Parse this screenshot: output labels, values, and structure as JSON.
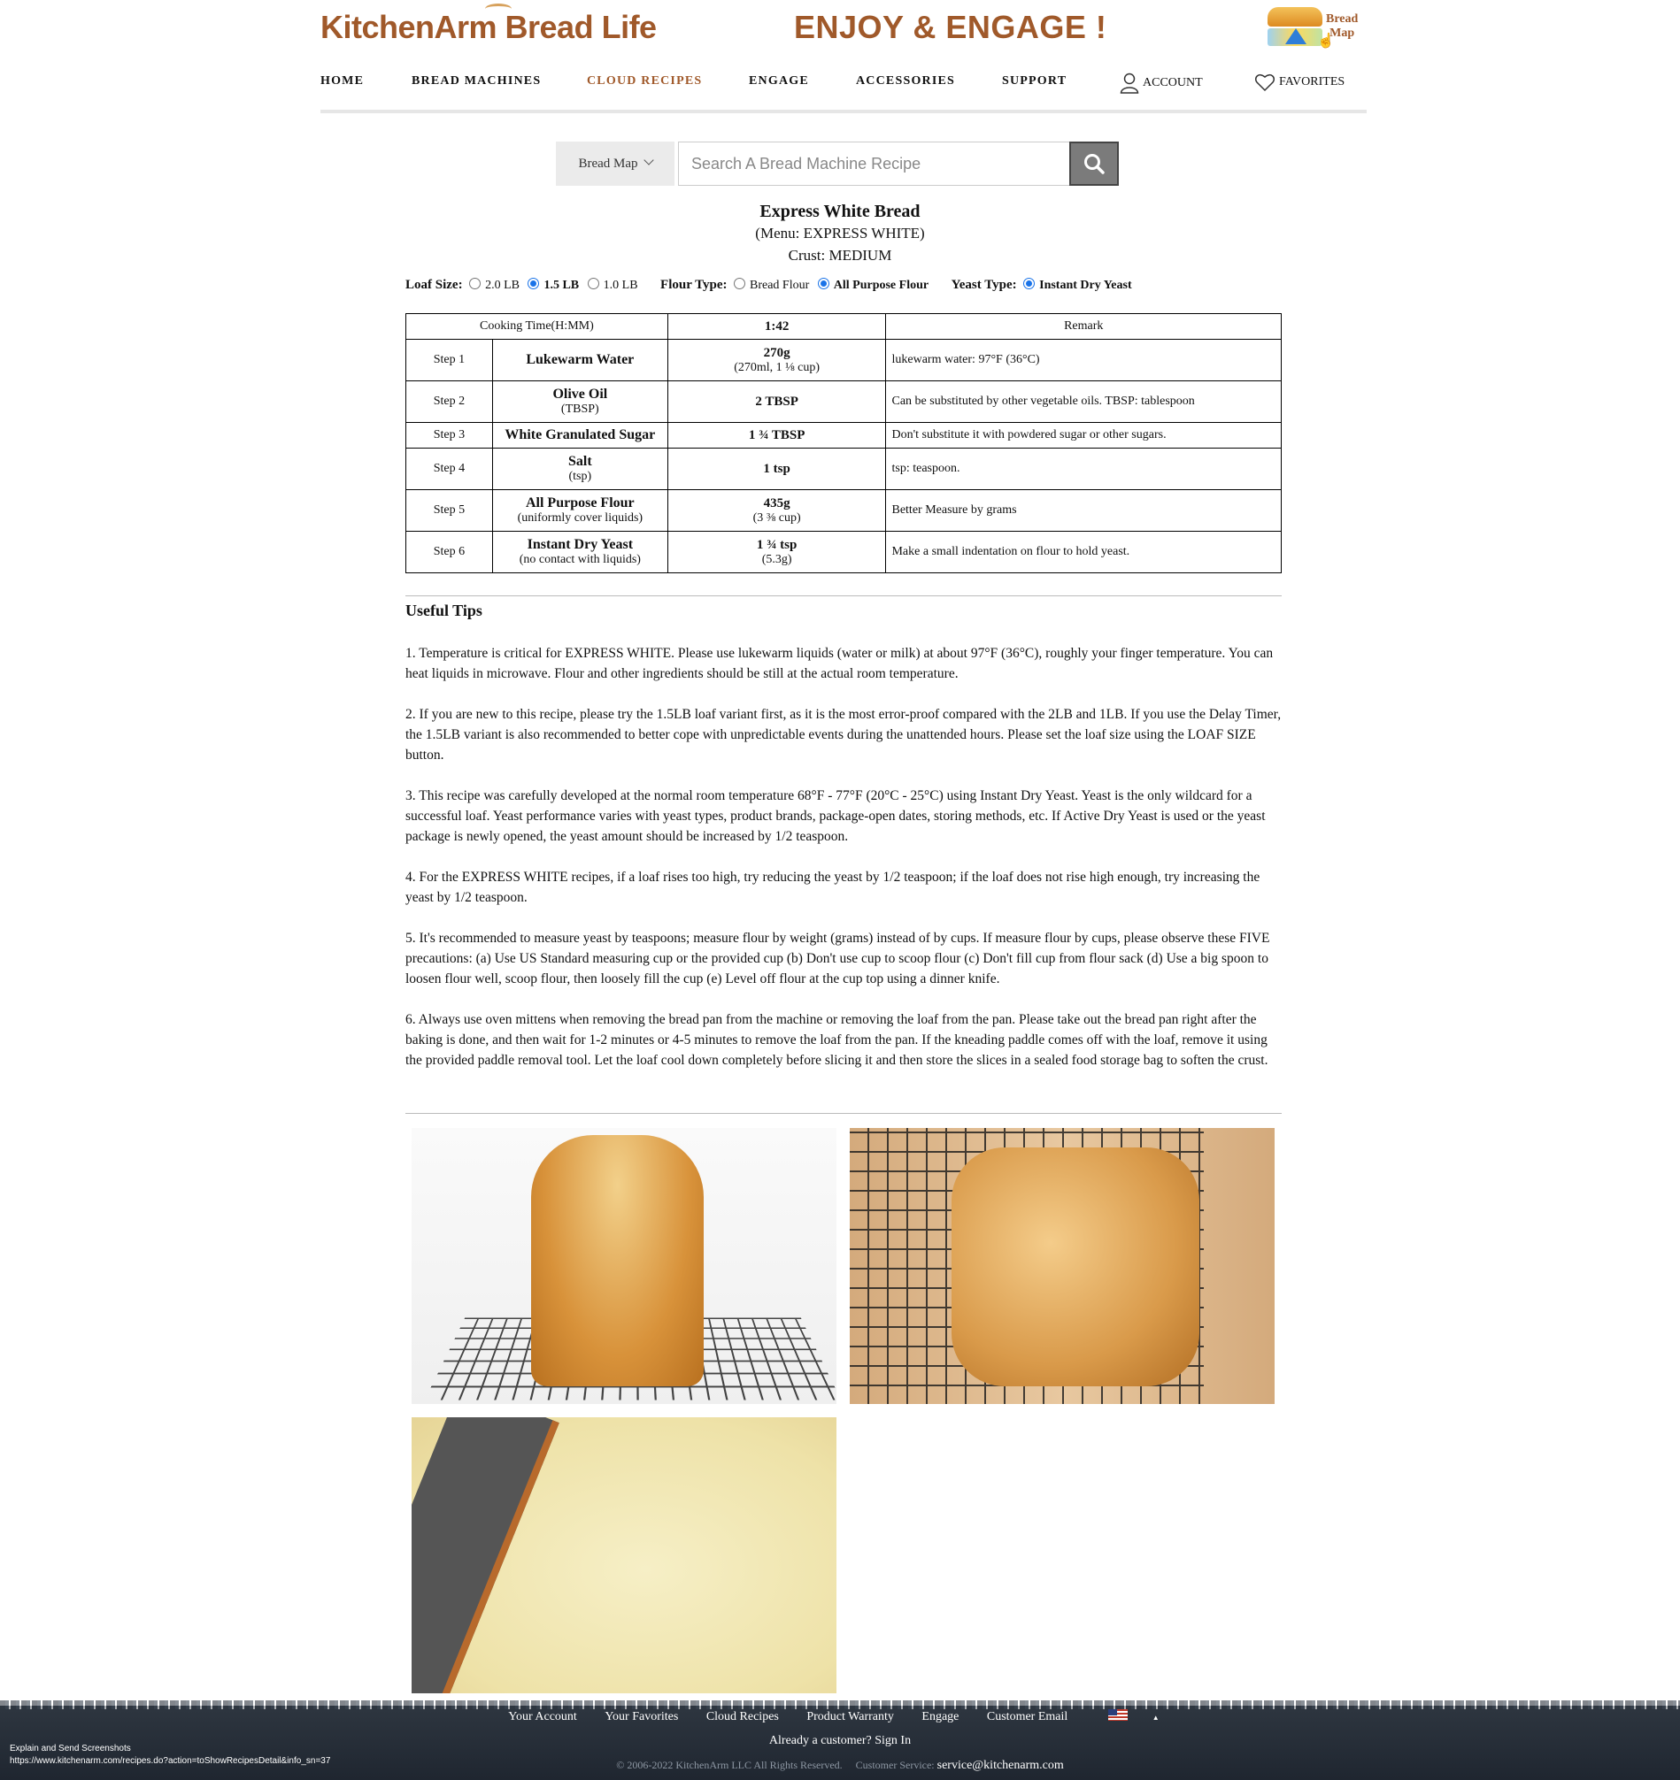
{
  "header": {
    "logo_text": "KitchenArm Bread Life",
    "tagline": "ENJOY & ENGAGE !",
    "bread_map_line1": "Bread",
    "bread_map_line2": "Map"
  },
  "nav": {
    "home": "HOME",
    "bread_machines": "BREAD MACHINES",
    "cloud_recipes": "CLOUD RECIPES",
    "engage": "ENGAGE",
    "accessories": "ACCESSORIES",
    "support": "SUPPORT",
    "account": "ACCOUNT",
    "favorites": "FAVORITES",
    "active_color": "#a0592a"
  },
  "search": {
    "select_value": "Bread Map",
    "placeholder": "Search A Bread Machine Recipe"
  },
  "recipe": {
    "title": "Express White Bread",
    "menu": "(Menu: EXPRESS WHITE)",
    "crust": "Crust: MEDIUM"
  },
  "options": {
    "loaf_label": "Loaf Size:",
    "loaf": [
      "2.0 LB",
      "1.5 LB",
      "1.0 LB"
    ],
    "flour_label": "Flour Type:",
    "flour": [
      "Bread Flour",
      "All Purpose Flour"
    ],
    "yeast_label": "Yeast Type:",
    "yeast": [
      "Instant Dry Yeast"
    ]
  },
  "table": {
    "cooking_time_label": "Cooking Time(H:MM)",
    "cooking_time": "1:42",
    "remark_header": "Remark",
    "steps": [
      {
        "step": "Step 1",
        "ingredient": "Lukewarm Water",
        "note": "",
        "amount": "270g",
        "amount_sub": "(270ml, 1 ⅛ cup)",
        "remark": "lukewarm water: 97°F (36°C)"
      },
      {
        "step": "Step 2",
        "ingredient": "Olive Oil",
        "note": "(TBSP)",
        "amount": "2 TBSP",
        "amount_sub": "",
        "remark": "Can be substituted by other vegetable oils. TBSP: tablespoon"
      },
      {
        "step": "Step 3",
        "ingredient": "White Granulated Sugar",
        "note": "",
        "amount": "1 ¾ TBSP",
        "amount_sub": "",
        "remark": "Don't substitute it with powdered sugar or other sugars."
      },
      {
        "step": "Step 4",
        "ingredient": "Salt",
        "note": "(tsp)",
        "amount": "1 tsp",
        "amount_sub": "",
        "remark": "tsp: teaspoon."
      },
      {
        "step": "Step 5",
        "ingredient": "All Purpose Flour",
        "note": "(uniformly cover liquids)",
        "amount": "435g",
        "amount_sub": "(3 ⅜ cup)",
        "remark": "Better Measure by grams"
      },
      {
        "step": "Step 6",
        "ingredient": "Instant Dry Yeast",
        "note": "(no contact with liquids)",
        "amount": "1 ¾ tsp",
        "amount_sub": "(5.3g)",
        "remark": "Make a small indentation on flour to hold yeast."
      }
    ]
  },
  "tips": {
    "title": "Useful Tips",
    "items": [
      "1. Temperature is critical for EXPRESS WHITE. Please use lukewarm liquids (water or milk) at about 97°F (36°C), roughly your finger temperature. You can heat liquids in microwave. Flour and other ingredients should be still at the actual room temperature.",
      "2. If you are new to this recipe, please try the 1.5LB loaf variant first, as it is the most error-proof compared with the 2LB and 1LB. If you use the Delay Timer, the 1.5LB variant is also recommended to better cope with unpredictable events during the unattended hours. Please set the loaf size using the LOAF SIZE button.",
      "3. This recipe was carefully developed at the normal room temperature 68°F - 77°F (20°C - 25°C) using Instant Dry Yeast. Yeast is the only wildcard for a successful loaf. Yeast performance varies with yeast types, product brands, package-open dates, storing methods, etc. If Active Dry Yeast is used or the yeast package is newly opened, the yeast amount should be increased by 1/2 teaspoon.",
      "4. For the EXPRESS WHITE recipes, if a loaf rises too high, try reducing the yeast by 1/2 teaspoon; if the loaf does not rise high enough, try increasing the yeast by 1/2 teaspoon.",
      "5. It's recommended to measure yeast by teaspoons; measure flour by weight (grams) instead of by cups. If measure flour by cups, please observe these FIVE precautions: (a) Use US Standard measuring cup or the provided cup (b) Don't use cup to scoop flour (c) Don't fill cup from flour sack (d) Use a big spoon to loosen flour well, scoop flour, then loosely fill the cup (e) Level off flour at the cup top using a dinner knife.",
      "6. Always use oven mittens when removing the bread pan from the machine or removing the loaf from the pan. Please take out the bread pan right after the baking is done, and then wait for 1-2 minutes or 4-5 minutes to remove the loaf from the pan. If the kneading paddle comes off with the loaf, remove it using the provided paddle removal tool. Let the loaf cool down completely before slicing it and then store the slices in a sealed food storage bag to soften the crust."
    ]
  },
  "footer": {
    "links": [
      "Your Account",
      "Your Favorites",
      "Cloud Recipes",
      "Product Warranty",
      "Engage",
      "Customer Email"
    ],
    "signin": "Already a customer? Sign In",
    "copyright": "© 2006-2022 KitchenArm LLC All Rights Reserved.",
    "service_label": "Customer Service:",
    "service_email": "service@kitchenarm.com",
    "corner_line1": "Explain and Send Screenshots",
    "corner_line2": "https://www.kitchenarm.com/recipes.do?action=toShowRecipesDetail&info_sn=37"
  }
}
